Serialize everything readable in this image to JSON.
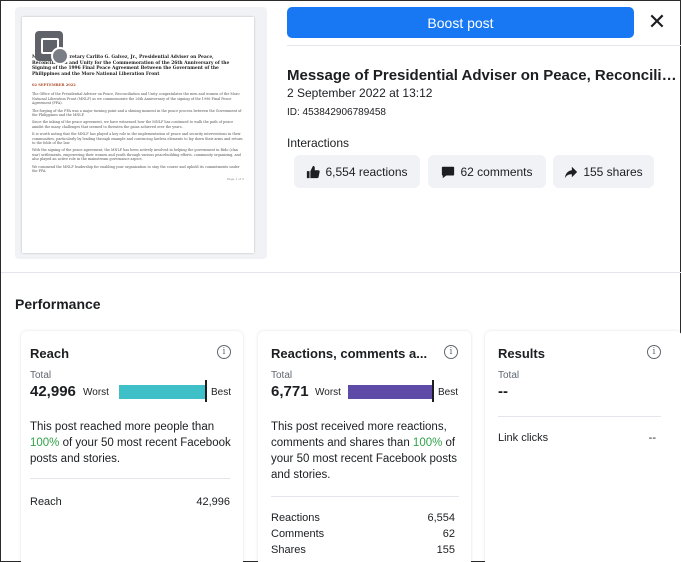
{
  "post_preview": {
    "document": {
      "title": "Message of Secretary Carlito G. Galvez, Jr., Presidential Adviser on Peace, Reconciliation and Unity for the Commemoration of the 26th Anniversary of the Signing of the 1996 Final Peace Agreement Between the Government of the Philippines and the Moro National Liberation Front",
      "date": "02 SEPTEMBER 2022",
      "paragraphs": [
        "The Office of the Presidential Adviser on Peace, Reconciliation and Unity congratulates the men and women of the Moro National Liberation Front (MNLF) as we commemorate the 26th Anniversary of the signing of the 1996 Final Peace Agreement (FPA).",
        "The forging of the FPA was a major turning point and a shining moment in the peace process between the Government of the Philippines and the MNLF.",
        "Since the inking of the peace agreement, we have witnessed how the MNLF has continued to walk the path of peace amidst the many challenges that seemed to threaten the gains achieved over the years.",
        "It is worth noting that the MNLF has played a key role in the implementation of peace and security interventions in their communities, particularly by leading through example and convincing lawless elements to lay down their arms and return to the folds of the law.",
        "With the signing of the peace agreement, the MNLF has been actively involved in helping the government in Rido (clan war) settlements, empowering their women and youth through various peacebuilding efforts, community organizing, and also played an active role in the mainstream governance aspect.",
        "We commend the MNLF leadership for enabling your organization to stay the course and uphold its commitments under the FPA."
      ],
      "page": "Page 1 of 2"
    }
  },
  "header": {
    "boost_label": "Boost post",
    "close_symbol": "✕"
  },
  "post": {
    "title": "Message of Presidential Adviser on Peace, Reconciliation a...",
    "date": "2 September 2022 at 13:12",
    "id": "ID: 453842906789458"
  },
  "interactions": {
    "label": "Interactions",
    "reactions": "6,554 reactions",
    "comments": "62 comments",
    "shares": "155 shares"
  },
  "performance": {
    "title": "Performance",
    "reach": {
      "title": "Reach",
      "total_label": "Total",
      "total": "42,996",
      "worst": "Worst",
      "best": "Best",
      "bar_fill": 1.0,
      "bar_color": "#3fbfc7",
      "desc_before": "This post reached more people than ",
      "pct": "100%",
      "desc_after": " of your 50 most recent Facebook posts and stories.",
      "row_label": "Reach",
      "row_value": "42,996"
    },
    "rcs": {
      "title": "Reactions, comments a...",
      "total_label": "Total",
      "total": "6,771",
      "worst": "Worst",
      "best": "Best",
      "bar_fill": 1.0,
      "bar_color": "#5e4ba8",
      "desc_before": "This post received more reactions, comments and shares than ",
      "pct": "100%",
      "desc_after": " of your 50 most recent Facebook posts and stories.",
      "rows": [
        {
          "label": "Reactions",
          "value": "6,554"
        },
        {
          "label": "Comments",
          "value": "62"
        },
        {
          "label": "Shares",
          "value": "155"
        }
      ]
    },
    "results": {
      "title": "Results",
      "total_label": "Total",
      "total": "--",
      "row_label": "Link clicks",
      "row_value": "--"
    }
  },
  "colors": {
    "accent": "#1877f2",
    "positive": "#31a24c"
  }
}
